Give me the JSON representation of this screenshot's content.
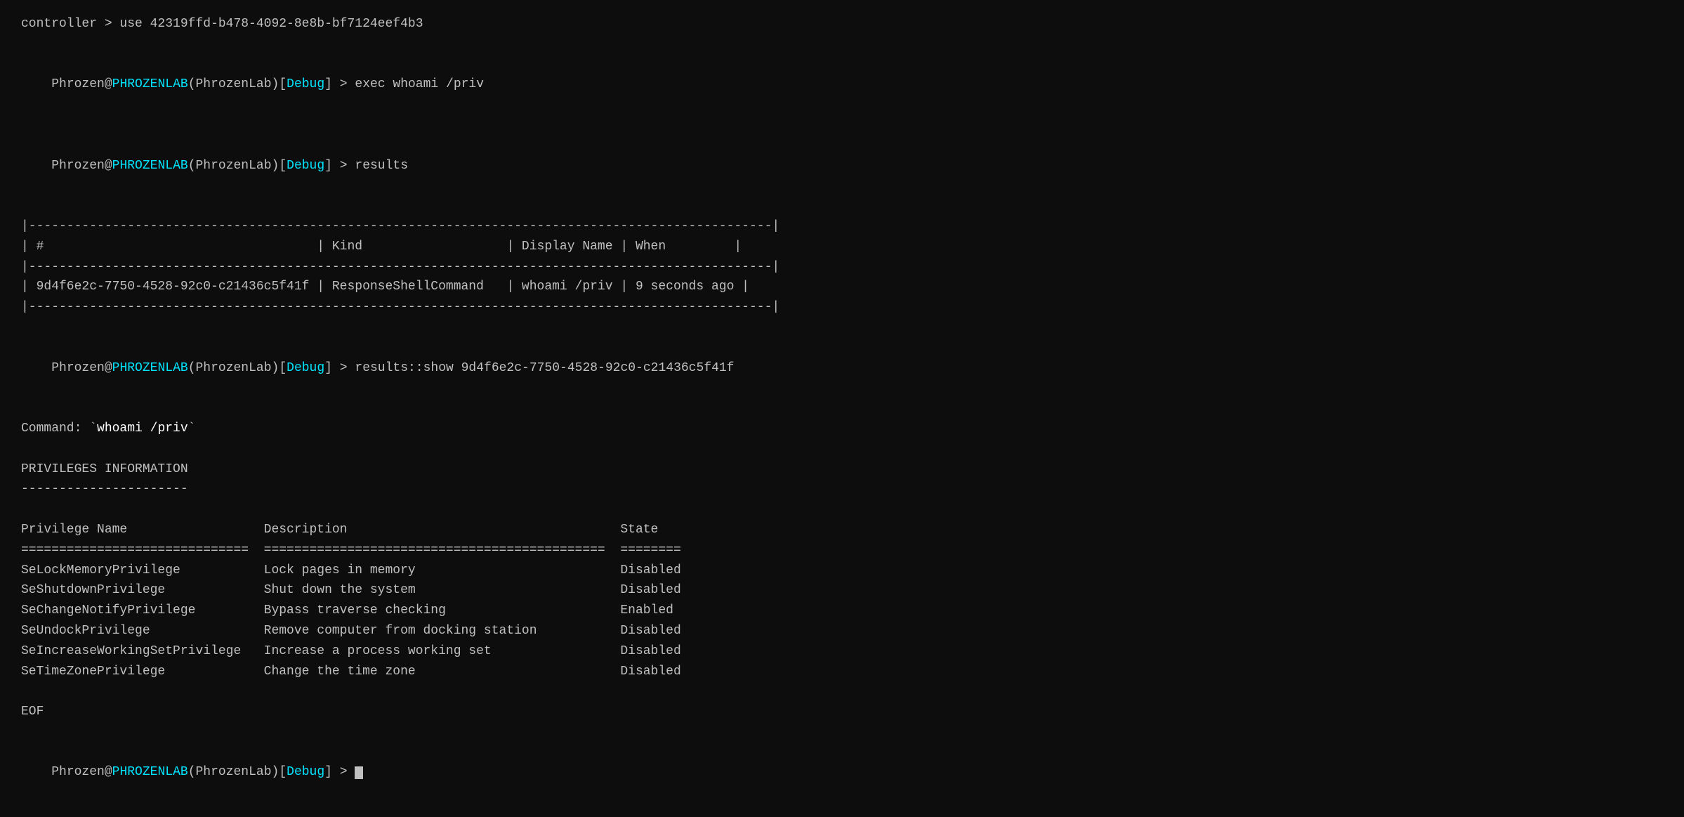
{
  "terminal": {
    "lines": [
      {
        "id": "line-controller",
        "type": "command",
        "parts": [
          {
            "text": "controller > use 42319ffd-b478-4092-8e8b-bf7124eef4b3",
            "class": "color-white"
          }
        ]
      },
      {
        "id": "blank1",
        "type": "blank"
      },
      {
        "id": "line-exec",
        "type": "prompt-command",
        "prompt_user": "Phrozen",
        "prompt_at": "@",
        "prompt_host": "PHROZENLAB",
        "prompt_paren_open": "(",
        "prompt_group": "PhrozenLab",
        "prompt_paren_close": ")",
        "prompt_debug_open": "[",
        "prompt_debug": "Debug",
        "prompt_debug_close": "]",
        "prompt_arrow": " > ",
        "command": "exec whoami /priv"
      },
      {
        "id": "blank2",
        "type": "blank"
      },
      {
        "id": "line-results",
        "type": "prompt-command",
        "prompt_user": "Phrozen",
        "prompt_at": "@",
        "prompt_host": "PHROZENLAB",
        "prompt_paren_open": "(",
        "prompt_group": "PhrozenLab",
        "prompt_paren_close": ")",
        "prompt_debug_open": "[",
        "prompt_debug": "Debug",
        "prompt_debug_close": "]",
        "prompt_arrow": " > ",
        "command": "results"
      },
      {
        "id": "blank3",
        "type": "blank"
      },
      {
        "id": "table-border1",
        "type": "plain",
        "text": "|--------------------------------------------------------------------------------------------------|"
      },
      {
        "id": "table-header1",
        "type": "plain",
        "text": "| #                                    | Kind                   | Display Name | When         |"
      },
      {
        "id": "table-border2",
        "type": "plain",
        "text": "|--------------------------------------------------------------------------------------------------|"
      },
      {
        "id": "table-row1",
        "type": "plain",
        "text": "| 9d4f6e2c-7750-4528-92c0-c21436c5f41f | ResponseShellCommand   | whoami /priv | 9 seconds ago |"
      },
      {
        "id": "table-border3",
        "type": "plain",
        "text": "|--------------------------------------------------------------------------------------------------|"
      },
      {
        "id": "blank4",
        "type": "blank"
      },
      {
        "id": "line-results-show",
        "type": "prompt-command",
        "prompt_user": "Phrozen",
        "prompt_at": "@",
        "prompt_host": "PHROZENLAB",
        "prompt_paren_open": "(",
        "prompt_group": "PhrozenLab",
        "prompt_paren_close": ")",
        "prompt_debug_open": "[",
        "prompt_debug": "Debug",
        "prompt_debug_close": "]",
        "prompt_arrow": " > ",
        "command": "results::show 9d4f6e2c-7750-4528-92c0-c21436c5f41f"
      },
      {
        "id": "blank5",
        "type": "blank"
      },
      {
        "id": "line-command-label",
        "type": "plain-with-highlight",
        "prefix": "Command: `",
        "highlight": "whoami /priv",
        "suffix": "`"
      },
      {
        "id": "blank6",
        "type": "blank"
      },
      {
        "id": "line-priv-info",
        "type": "plain",
        "text": "PRIVILEGES INFORMATION"
      },
      {
        "id": "line-priv-sep",
        "type": "plain",
        "text": "----------------------"
      },
      {
        "id": "blank7",
        "type": "blank"
      },
      {
        "id": "line-priv-header",
        "type": "plain",
        "text": "Privilege Name                  Description                                    State"
      },
      {
        "id": "line-priv-equals",
        "type": "plain",
        "text": "==============================  =============================================  ========"
      },
      {
        "id": "line-priv1",
        "type": "plain",
        "text": "SeLockMemoryPrivilege           Lock pages in memory                           Disabled"
      },
      {
        "id": "line-priv2",
        "type": "plain",
        "text": "SeShutdownPrivilege             Shut down the system                           Disabled"
      },
      {
        "id": "line-priv3",
        "type": "plain",
        "text": "SeChangeNotifyPrivilege         Bypass traverse checking                       Enabled"
      },
      {
        "id": "line-priv4",
        "type": "plain",
        "text": "SeUndockPrivilege               Remove computer from docking station           Disabled"
      },
      {
        "id": "line-priv5",
        "type": "plain",
        "text": "SeIncreaseWorkingSetPrivilege   Increase a process working set                 Disabled"
      },
      {
        "id": "line-priv6",
        "type": "plain",
        "text": "SeTimeZonePrivilege             Change the time zone                           Disabled"
      },
      {
        "id": "blank8",
        "type": "blank"
      },
      {
        "id": "line-eof",
        "type": "plain",
        "text": "EOF"
      },
      {
        "id": "blank9",
        "type": "blank"
      },
      {
        "id": "line-final-prompt",
        "type": "prompt-cursor",
        "prompt_user": "Phrozen",
        "prompt_at": "@",
        "prompt_host": "PHROZENLAB",
        "prompt_paren_open": "(",
        "prompt_group": "PhrozenLab",
        "prompt_paren_close": ")",
        "prompt_debug_open": "[",
        "prompt_debug": "Debug",
        "prompt_debug_close": "]",
        "prompt_arrow": " > "
      }
    ]
  }
}
